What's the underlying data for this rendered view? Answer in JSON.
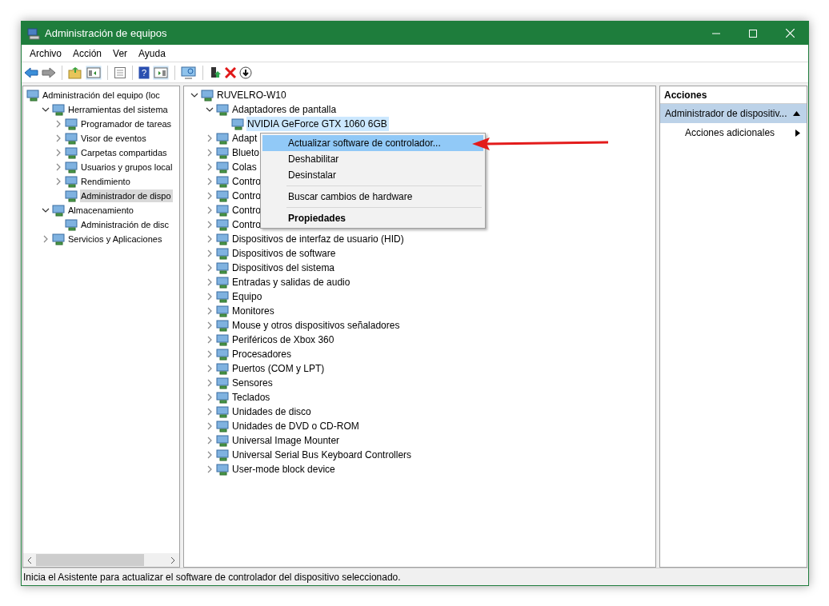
{
  "window": {
    "title": "Administración de equipos"
  },
  "menu_bar": [
    "Archivo",
    "Acción",
    "Ver",
    "Ayuda"
  ],
  "toolbar": {
    "help_glyph": "?"
  },
  "navigation_tree": [
    {
      "label": "Administración del equipo (loc",
      "selected": false,
      "children": [
        {
          "label": "Herramientas del sistema",
          "expanded": true,
          "selected": false,
          "children": [
            {
              "label": "Programador de tareas",
              "expanded": false,
              "selected": false
            },
            {
              "label": "Visor de eventos",
              "expanded": false,
              "selected": false
            },
            {
              "label": "Carpetas compartidas",
              "expanded": false,
              "selected": false
            },
            {
              "label": "Usuarios y grupos local",
              "expanded": false,
              "selected": false
            },
            {
              "label": "Rendimiento",
              "expanded": false,
              "selected": false
            },
            {
              "label": "Administrador de dispo",
              "selected": true
            }
          ]
        },
        {
          "label": "Almacenamiento",
          "expanded": true,
          "selected": false,
          "children": [
            {
              "label": "Administración de disc",
              "selected": false
            }
          ]
        },
        {
          "label": "Servicios y Aplicaciones",
          "expanded": false,
          "selected": false
        }
      ]
    }
  ],
  "device_tree": [
    {
      "label": "RUVELRO-W10",
      "expanded": true,
      "selected": false,
      "children": [
        {
          "label": "Adaptadores de pantalla",
          "expanded": true,
          "selected": false,
          "children": [
            {
              "label": "NVIDIA GeForce GTX 1060 6GB",
              "selected": true
            }
          ]
        },
        {
          "label": "Adapt",
          "expanded": false,
          "selected": false
        },
        {
          "label": "Blueto",
          "expanded": false,
          "selected": false
        },
        {
          "label": "Colas",
          "expanded": false,
          "selected": false
        },
        {
          "label": "Contro",
          "expanded": false,
          "selected": false
        },
        {
          "label": "Contro",
          "expanded": false,
          "selected": false
        },
        {
          "label": "Contro",
          "expanded": false,
          "selected": false
        },
        {
          "label": "Contro",
          "expanded": false,
          "selected": false
        },
        {
          "label": "Dispositivos de interfaz de usuario (HID)",
          "expanded": false,
          "selected": false
        },
        {
          "label": "Dispositivos de software",
          "expanded": false,
          "selected": false
        },
        {
          "label": "Dispositivos del sistema",
          "expanded": false,
          "selected": false
        },
        {
          "label": "Entradas y salidas de audio",
          "expanded": false,
          "selected": false
        },
        {
          "label": "Equipo",
          "expanded": false,
          "selected": false
        },
        {
          "label": "Monitores",
          "expanded": false,
          "selected": false
        },
        {
          "label": "Mouse y otros dispositivos señaladores",
          "expanded": false,
          "selected": false
        },
        {
          "label": "Periféricos de Xbox 360",
          "expanded": false,
          "selected": false
        },
        {
          "label": "Procesadores",
          "expanded": false,
          "selected": false
        },
        {
          "label": "Puertos (COM y LPT)",
          "expanded": false,
          "selected": false
        },
        {
          "label": "Sensores",
          "expanded": false,
          "selected": false
        },
        {
          "label": "Teclados",
          "expanded": false,
          "selected": false
        },
        {
          "label": "Unidades de disco",
          "expanded": false,
          "selected": false
        },
        {
          "label": "Unidades de DVD o CD-ROM",
          "expanded": false,
          "selected": false
        },
        {
          "label": "Universal Image Mounter",
          "expanded": false,
          "selected": false
        },
        {
          "label": "Universal Serial Bus Keyboard Controllers",
          "expanded": false,
          "selected": false
        },
        {
          "label": "User-mode block device",
          "expanded": false,
          "selected": false
        }
      ]
    }
  ],
  "context_menu": [
    {
      "kind": "item",
      "label": "Actualizar software de controlador...",
      "selected": true,
      "default": false
    },
    {
      "kind": "item",
      "label": "Deshabilitar",
      "selected": false,
      "default": false
    },
    {
      "kind": "item",
      "label": "Desinstalar",
      "selected": false,
      "default": false
    },
    {
      "kind": "separator"
    },
    {
      "kind": "item",
      "label": "Buscar cambios de hardware",
      "selected": false,
      "default": false
    },
    {
      "kind": "separator"
    },
    {
      "kind": "item",
      "label": "Propiedades",
      "selected": false,
      "default": true
    }
  ],
  "actions_pane": {
    "title": "Acciones",
    "section": "Administrador de dispositiv...",
    "items": [
      "Acciones adicionales"
    ]
  },
  "status_bar": "Inicia el Asistente para actualizar el software de controlador del dispositivo seleccionado."
}
